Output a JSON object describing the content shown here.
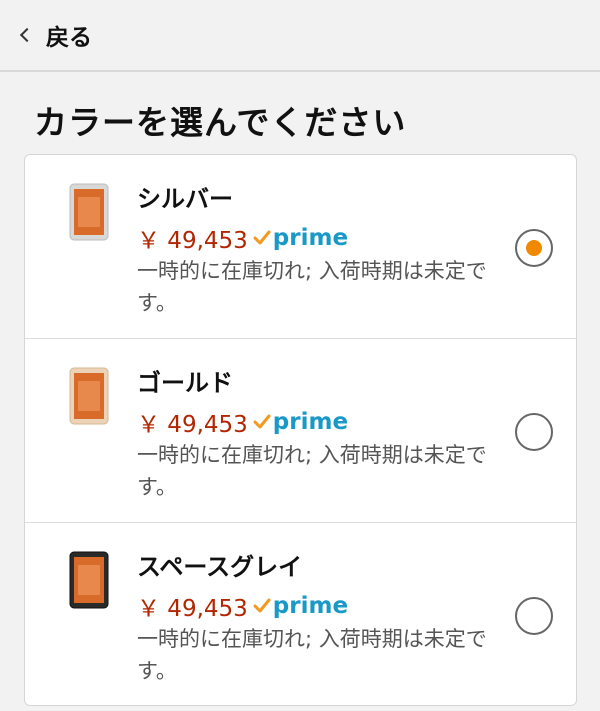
{
  "header": {
    "back_label": "戻る"
  },
  "heading": "カラーを選んでください",
  "options": [
    {
      "name": "シルバー",
      "price": "￥ 49,453",
      "prime_label": "prime",
      "status": "一時的に在庫切れ; 入荷時期は未定です。",
      "selected": true,
      "device_color": "silver"
    },
    {
      "name": "ゴールド",
      "price": "￥ 49,453",
      "prime_label": "prime",
      "status": "一時的に在庫切れ; 入荷時期は未定です。",
      "selected": false,
      "device_color": "gold"
    },
    {
      "name": "スペースグレイ",
      "price": "￥ 49,453",
      "prime_label": "prime",
      "status": "一時的に在庫切れ; 入荷時期は未定です。",
      "selected": false,
      "device_color": "space-gray"
    }
  ],
  "colors": {
    "price": "#b12704",
    "prime": "#1a98c8",
    "check": "#f29a1e",
    "radio_selected": "#f08800"
  }
}
